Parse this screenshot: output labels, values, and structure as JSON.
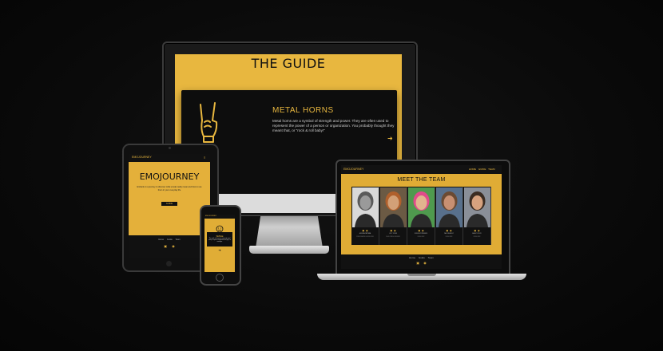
{
  "desktop": {
    "page_title": "THE GUIDE",
    "card": {
      "heading": "METAL HORNS",
      "description": "Metal horns are a symbol of strength and power. They are often used to represent the power of a person or organization. You probably thought they meant that, or \"rock & roll baby!\"",
      "icon": "metal-horns-icon",
      "arrow": "➜"
    }
  },
  "tablet": {
    "brand": "EMOJOURNEY",
    "menu_icon": "≡",
    "hero_title": "EMOJOURNEY",
    "hero_subtitle": "Embark on a journey to discover what emojis really mean and how to use them in your everyday life",
    "cta": "GUIDE",
    "footer_links": "Home  Guide  Team",
    "footer_icons": "▣ ◉"
  },
  "phone": {
    "brand": "EMOJOURNEY",
    "emoji_label": "SMILE",
    "emoji_text": "The smile is the most commonly used emoji to express happiness and joy in a message.",
    "arrow": "➜"
  },
  "laptop": {
    "brand": "EMOJOURNEY",
    "nav_links": "HOME  GUIDE  TEAM",
    "heading": "MEET THE TEAM",
    "team": [
      {
        "name": "ALESSIA PARTAMA",
        "role": "SCRUM MASTER & DEVELOPER",
        "tone": "#9a9a9a",
        "hair": "#5a5a5a",
        "bg": "#d9d9d9"
      },
      {
        "name": "LUCY JONES",
        "role": "DEVELOPER & DESIGNER",
        "tone": "#d2a077",
        "hair": "#b0602c",
        "bg": "#6b5a44"
      },
      {
        "name": "JESSICA TOWNSEND",
        "role": "DEVELOPER",
        "tone": "#e2b48e",
        "hair": "#e04b8a",
        "bg": "#4f9a4e"
      },
      {
        "name": "PAUL BRADLEY",
        "role": "DEVELOPER",
        "tone": "#c89072",
        "hair": "#6b4a32",
        "bg": "#58708c"
      },
      {
        "name": "ASHLEY ROCK",
        "role": "DEVELOPER",
        "tone": "#d7a27f",
        "hair": "#3b2c22",
        "bg": "#8a8f98"
      }
    ],
    "member_icons": "▣ ◉",
    "footer_links": "Home  Guide  Team",
    "footer_icons": "▣ ◉"
  },
  "colors": {
    "accent": "#e8b73f",
    "dark": "#111111"
  }
}
